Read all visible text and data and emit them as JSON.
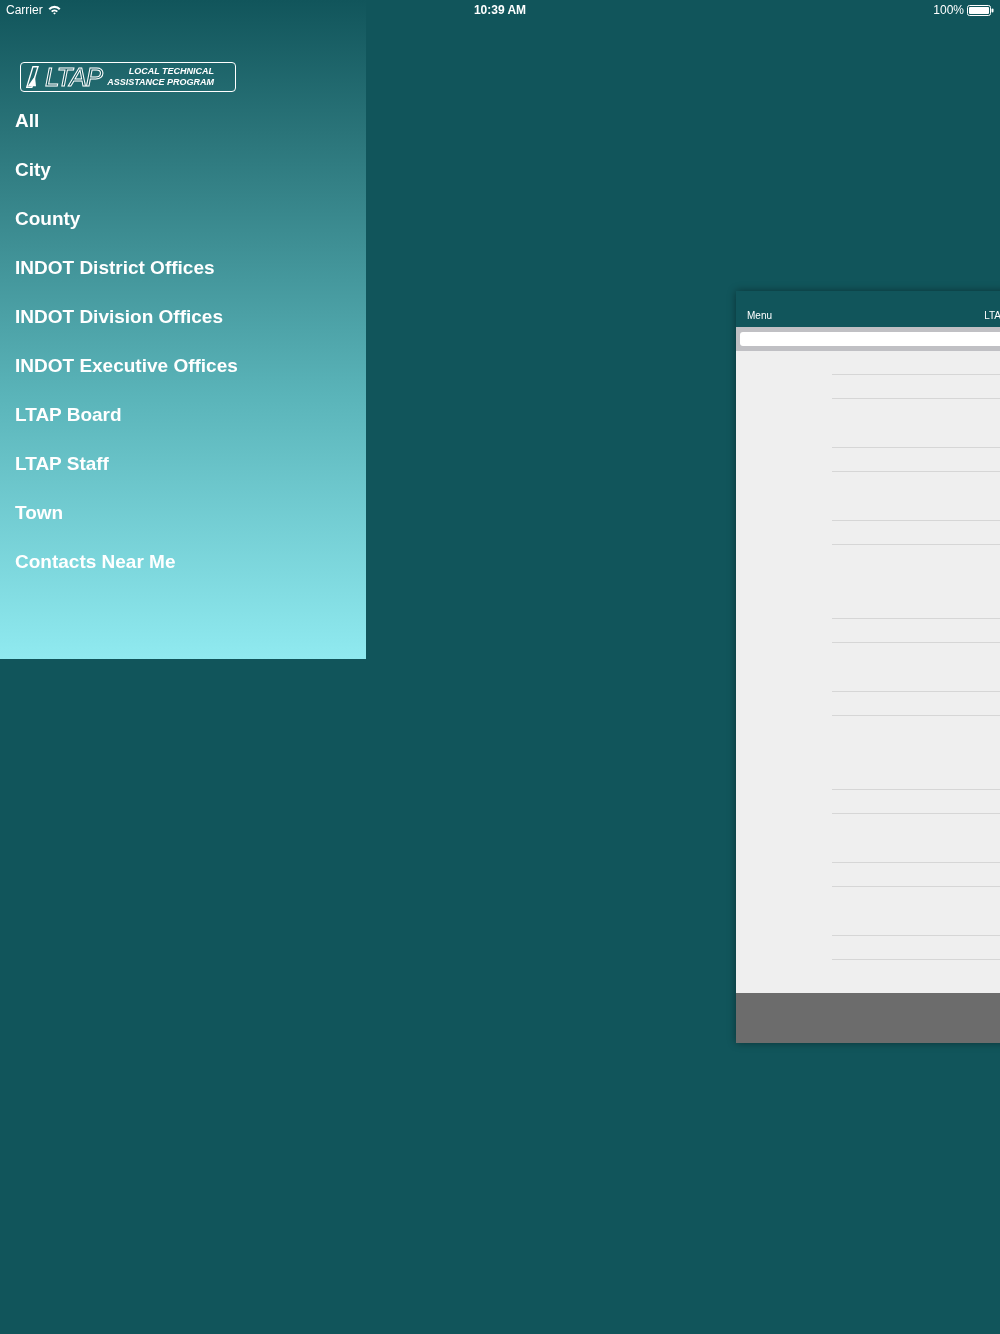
{
  "status_bar": {
    "carrier": "Carrier",
    "time": "10:39 AM",
    "battery": "100%"
  },
  "sidebar": {
    "logo": {
      "mark": "LTAP",
      "line_1": "LOCAL TECHNICAL",
      "line_2": "ASSISTANCE PROGRAM"
    },
    "items": [
      {
        "label": "All"
      },
      {
        "label": "City"
      },
      {
        "label": "County"
      },
      {
        "label": "INDOT District Offices"
      },
      {
        "label": "INDOT Division Offices"
      },
      {
        "label": "INDOT Executive Offices"
      },
      {
        "label": "LTAP Board"
      },
      {
        "label": "LTAP Staff"
      },
      {
        "label": "Town"
      },
      {
        "label": "Contacts Near Me"
      }
    ]
  },
  "content_preview": {
    "menu_button": "Menu",
    "title": "LTA"
  }
}
